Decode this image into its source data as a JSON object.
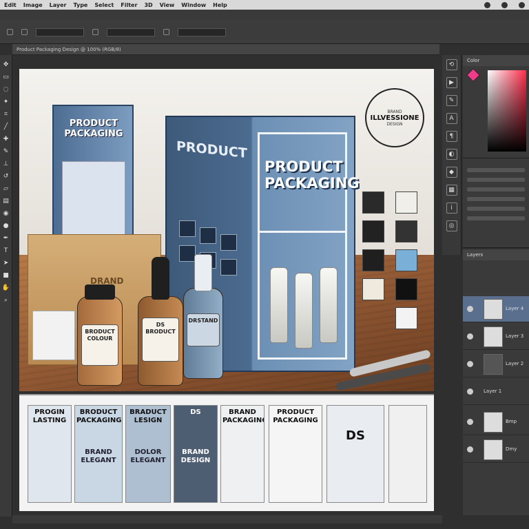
{
  "menubar": {
    "items": [
      "Edit",
      "Image",
      "Layer",
      "Type",
      "Select",
      "Filter",
      "3D",
      "View",
      "Window",
      "Help"
    ]
  },
  "doc_tab": {
    "title": "Product Packaging Design @ 100% (RGB/8)"
  },
  "canvas": {
    "small_box_title": "PRODUCT PACKAGING",
    "big_box_side_title": "PRODUCT",
    "big_box_front_title": "PRODUCT PACKAGING",
    "cardboard_label": "DRAND",
    "stamp": {
      "top": "BRAND",
      "main": "ILLVESSIONE",
      "bottom": "DESIGN"
    },
    "bottles": [
      {
        "label": "BRODUCT COLOUR"
      },
      {
        "label": "DS BRODUCT"
      },
      {
        "label": "DRSTAND"
      }
    ]
  },
  "strip": {
    "thumbs": [
      {
        "top": "PROGIN LASTING",
        "bottom": ""
      },
      {
        "top": "BRODUCT PACKAGING",
        "bottom": "BRAND ELEGANT"
      },
      {
        "top": "BRADUCT LESIGN",
        "bottom": "DOLOR ELEGANT"
      },
      {
        "top": "DS",
        "bottom": "BRAND DESIGN"
      },
      {
        "top": "BRAND PACKAGING",
        "bottom": ""
      },
      {
        "top": "PRODUCT PACKAGING",
        "bottom": ""
      },
      {
        "top": "DS",
        "bottom": ""
      }
    ]
  },
  "panels": {
    "color_header": "Color",
    "layers_header": "Layers",
    "layers": [
      "Layer 4",
      "Layer 3",
      "Layer 2",
      "Layer 1",
      "Bmp",
      "Dmy"
    ]
  },
  "colors": {
    "box_blue": "#4b6b8f",
    "accent_pink": "#f03a8a"
  }
}
